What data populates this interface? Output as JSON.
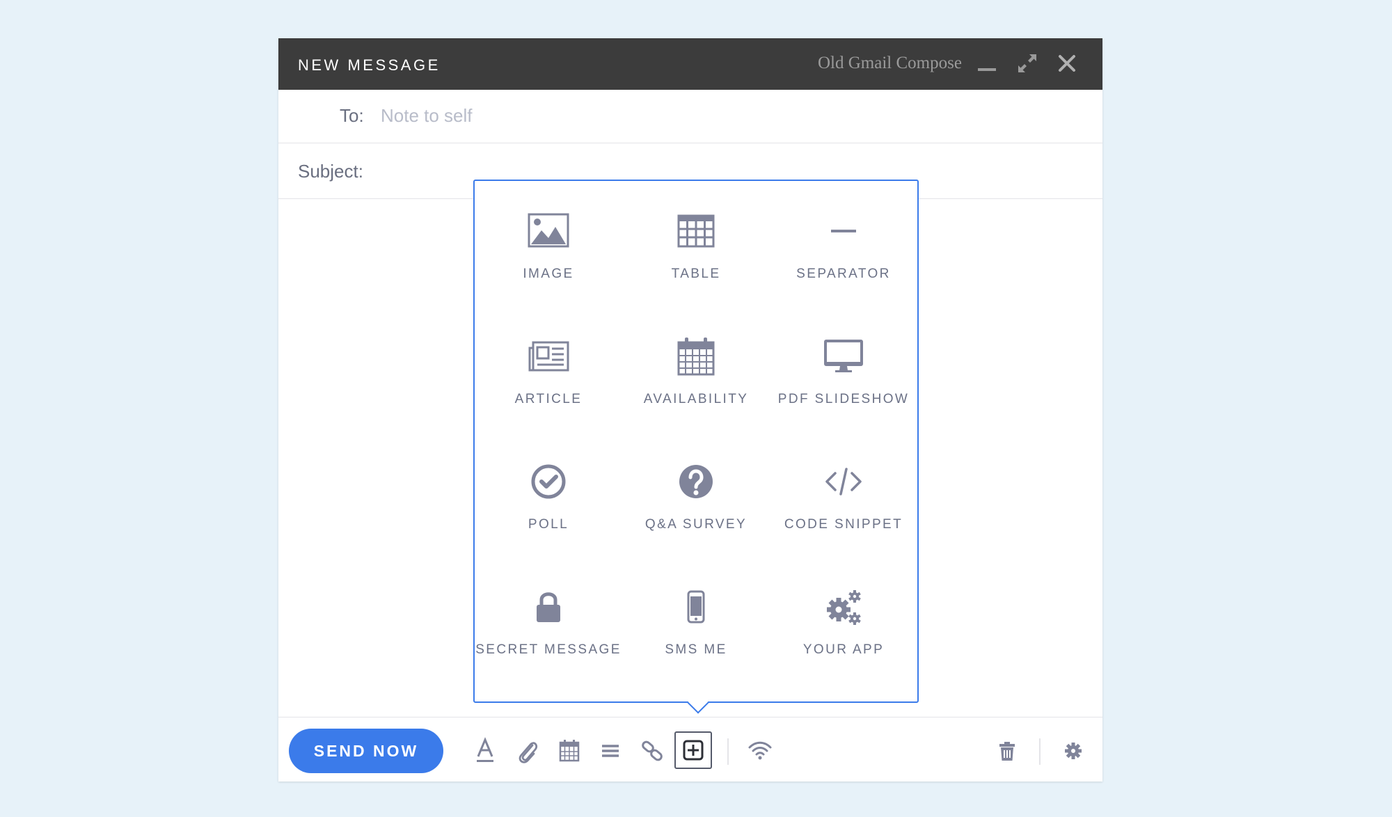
{
  "window": {
    "title": "NEW MESSAGE",
    "subtitle": "Old Gmail Compose"
  },
  "compose": {
    "to_label": "To:",
    "to_value": "Note to self",
    "subject_label": "Subject:"
  },
  "insert_menu": {
    "items": [
      {
        "label": "IMAGE",
        "icon": "image-icon"
      },
      {
        "label": "TABLE",
        "icon": "table-icon"
      },
      {
        "label": "SEPARATOR",
        "icon": "separator-icon"
      },
      {
        "label": "ARTICLE",
        "icon": "article-icon"
      },
      {
        "label": "AVAILABILITY",
        "icon": "calendar-icon"
      },
      {
        "label": "PDF SLIDESHOW",
        "icon": "monitor-icon"
      },
      {
        "label": "POLL",
        "icon": "check-circle-icon"
      },
      {
        "label": "Q&A SURVEY",
        "icon": "question-circle-icon"
      },
      {
        "label": "CODE SNIPPET",
        "icon": "code-icon"
      },
      {
        "label": "SECRET MESSAGE",
        "icon": "lock-icon"
      },
      {
        "label": "SMS ME",
        "icon": "phone-icon"
      },
      {
        "label": "YOUR APP",
        "icon": "gears-icon"
      }
    ]
  },
  "toolbar": {
    "send_label": "SEND NOW",
    "tools": [
      "text-format-icon",
      "paperclip-icon",
      "calendar-icon",
      "list-icon",
      "link-icon",
      "insert-plus-icon",
      "wifi-icon",
      "trash-icon",
      "gear-icon"
    ]
  },
  "colors": {
    "accent": "#3b7bea",
    "titlebar": "#3c3c3c",
    "icon": "#80849a",
    "background": "#e7f2f9"
  }
}
